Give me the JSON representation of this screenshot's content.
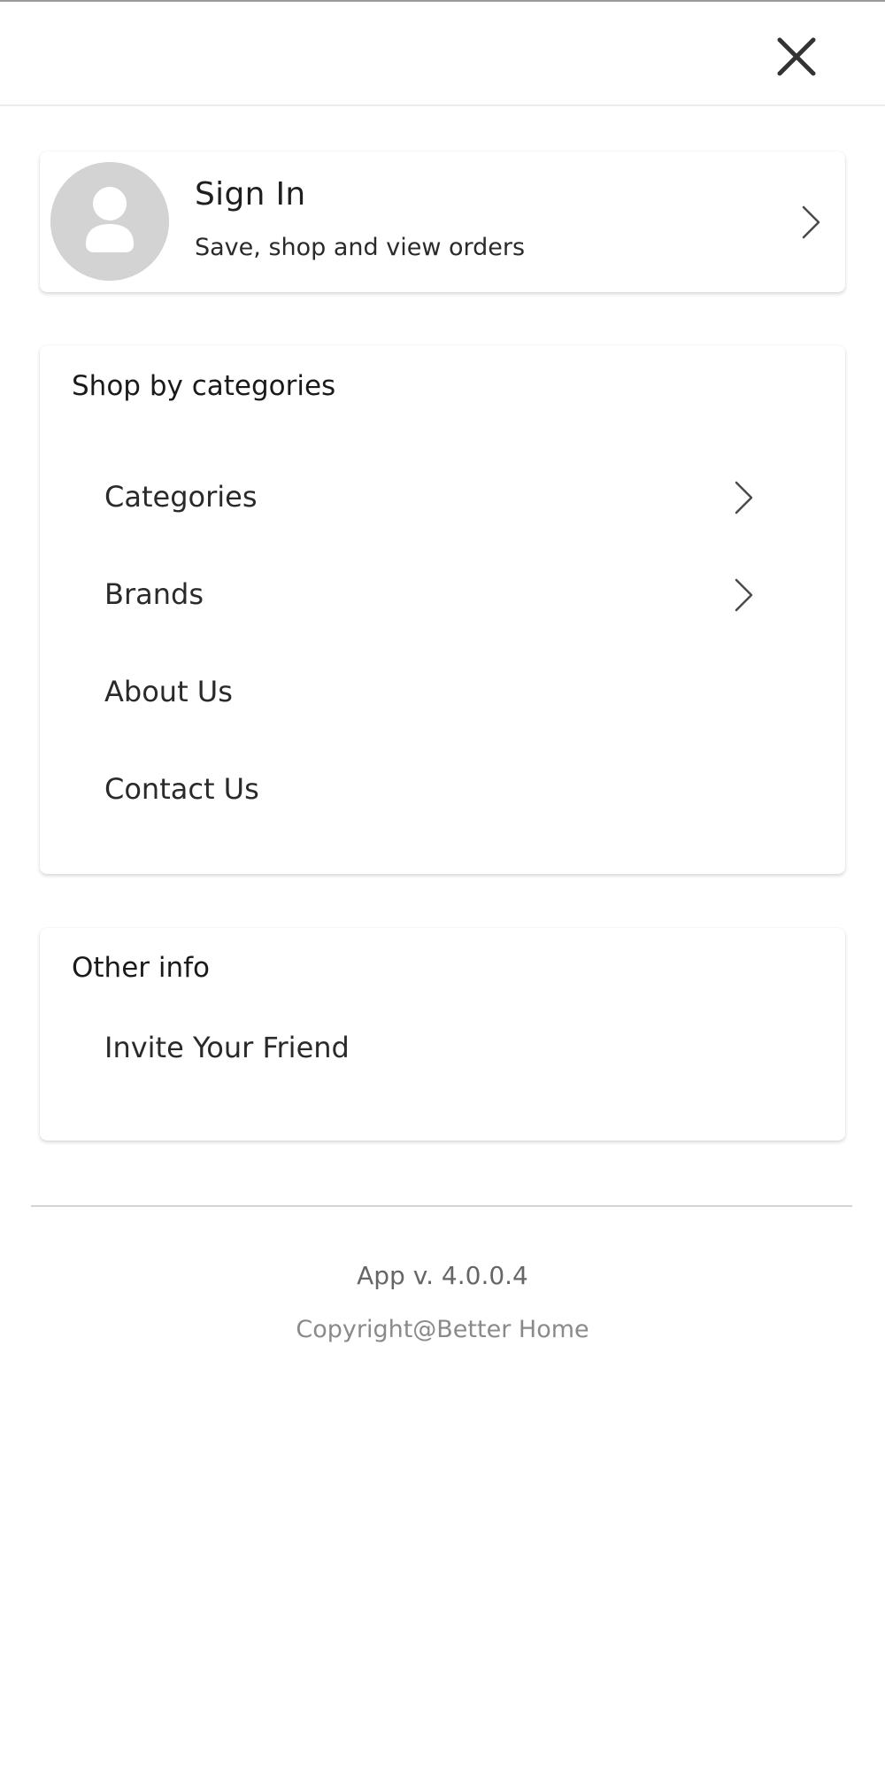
{
  "header": {
    "close_icon": "close-icon"
  },
  "signin": {
    "title": "Sign In",
    "subtitle": "Save, shop and view orders",
    "avatar_icon": "user-avatar-icon",
    "avatar_color": "#d3d3d3"
  },
  "shop_section": {
    "title": "Shop by categories",
    "items": [
      {
        "label": "Categories",
        "has_chevron": true
      },
      {
        "label": "Brands",
        "has_chevron": true
      },
      {
        "label": "About Us",
        "has_chevron": false
      },
      {
        "label": "Contact Us",
        "has_chevron": false
      }
    ]
  },
  "other_section": {
    "title": "Other info",
    "items": [
      {
        "label": "Invite Your Friend",
        "has_chevron": false
      }
    ]
  },
  "footer": {
    "version": "App v. 4.0.0.4",
    "copyright": "Copyright@Better Home"
  }
}
